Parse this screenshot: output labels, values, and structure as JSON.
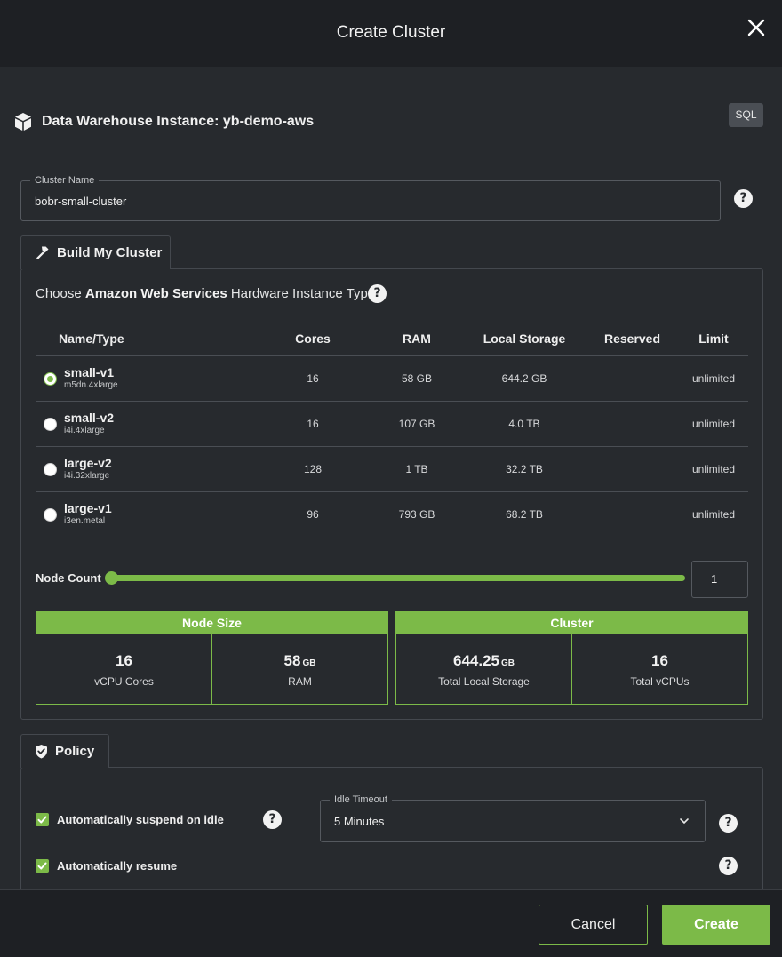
{
  "dialog": {
    "title": "Create Cluster"
  },
  "instance": {
    "title": "Data Warehouse Instance: yb-demo-aws",
    "badge": "SQL"
  },
  "cluster_name": {
    "label": "Cluster Name",
    "value": "bobr-small-cluster"
  },
  "build_tab": {
    "label": "Build My Cluster"
  },
  "hardware": {
    "prefix": "Choose ",
    "provider": "Amazon Web Services",
    "suffix": " Hardware Instance Type",
    "columns": [
      "Name/Type",
      "Cores",
      "RAM",
      "Local Storage",
      "Reserved",
      "Limit"
    ],
    "rows": [
      {
        "name": "small-v1",
        "type": "m5dn.4xlarge",
        "cores": "16",
        "ram": "58 GB",
        "storage": "644.2 GB",
        "reserved": "",
        "limit": "unlimited",
        "selected": true
      },
      {
        "name": "small-v2",
        "type": "i4i.4xlarge",
        "cores": "16",
        "ram": "107 GB",
        "storage": "4.0 TB",
        "reserved": "",
        "limit": "unlimited",
        "selected": false
      },
      {
        "name": "large-v2",
        "type": "i4i.32xlarge",
        "cores": "128",
        "ram": "1 TB",
        "storage": "32.2 TB",
        "reserved": "",
        "limit": "unlimited",
        "selected": false
      },
      {
        "name": "large-v1",
        "type": "i3en.metal",
        "cores": "96",
        "ram": "793 GB",
        "storage": "68.2 TB",
        "reserved": "",
        "limit": "unlimited",
        "selected": false
      }
    ]
  },
  "node_count": {
    "label": "Node Count",
    "value": "1",
    "slider_fraction": 0
  },
  "node_size": {
    "title": "Node Size",
    "cores_value": "16",
    "cores_label": "vCPU Cores",
    "ram_value": "58",
    "ram_unit": "GB",
    "ram_label": "RAM"
  },
  "cluster": {
    "title": "Cluster",
    "storage_value": "644.25",
    "storage_unit": "GB",
    "storage_label": "Total Local Storage",
    "vcpu_value": "16",
    "vcpu_label": "Total vCPUs"
  },
  "policy": {
    "tab_label": "Policy",
    "suspend_label": "Automatically suspend on idle",
    "suspend_checked": true,
    "resume_label": "Automatically resume",
    "resume_checked": true,
    "idle_timeout_label": "Idle Timeout",
    "idle_timeout_value": "5 Minutes"
  },
  "footer": {
    "cancel": "Cancel",
    "create": "Create"
  },
  "colors": {
    "accent": "#7cba48",
    "background": "#272a2e",
    "header": "#1e2024"
  }
}
